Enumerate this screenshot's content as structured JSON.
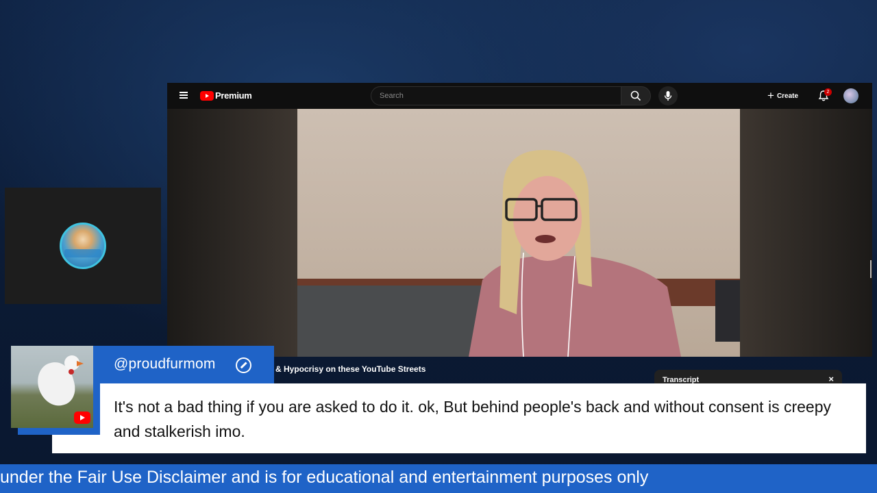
{
  "youtube": {
    "brand": "Premium",
    "search": {
      "placeholder": "Search"
    },
    "create_label": "Create",
    "notification_count": "2",
    "video_title_partial": "& Hypocrisy on these YouTube Streets",
    "transcript_label": "Transcript",
    "transcript_close": "×"
  },
  "comment": {
    "username": "@proudfurmom",
    "text": "It's not a bad thing if you are asked to do it. ok, But behind people's back and without consent is creepy and stalkerish imo."
  },
  "ticker": {
    "text": "under the Fair Use Disclaimer and is for educational and entertainment purposes only"
  },
  "colors": {
    "accent_blue": "#1f63c7",
    "youtube_red": "#ff0000",
    "background": "#0f2344"
  },
  "icons": [
    "menu-icon",
    "youtube-logo-icon",
    "search-icon",
    "mic-icon",
    "plus-icon",
    "bell-icon",
    "close-icon",
    "no-symbol-icon",
    "youtube-mini-icon"
  ]
}
